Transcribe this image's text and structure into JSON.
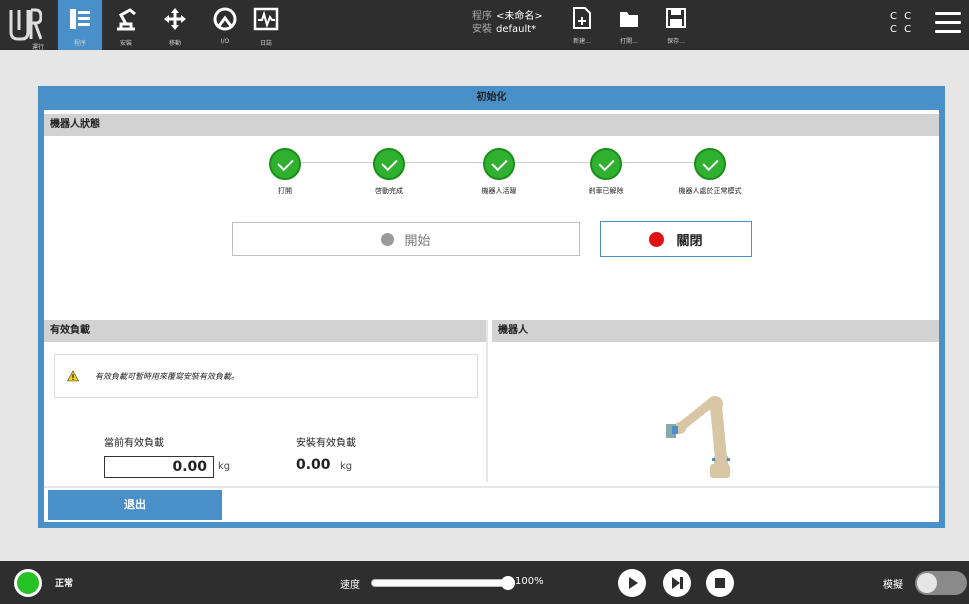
{
  "toolbar": {
    "nav": [
      {
        "label": "運行"
      },
      {
        "label": "程序"
      },
      {
        "label": "安裝"
      },
      {
        "label": "移動"
      },
      {
        "label": "I/O"
      },
      {
        "label": "日誌"
      }
    ],
    "program_key": "程序",
    "program_value": "<未命名>",
    "install_key": "安裝",
    "install_value": "default*",
    "file_buttons": [
      {
        "label": "新建..."
      },
      {
        "label": "打開..."
      },
      {
        "label": "保存..."
      }
    ],
    "cc_line1": "C C",
    "cc_line2": "C C"
  },
  "dialog": {
    "title": "初始化",
    "robot_state": {
      "heading": "機器人狀態",
      "steps": [
        {
          "label": "打開"
        },
        {
          "label": "啓動完成"
        },
        {
          "label": "機器人活躍"
        },
        {
          "label": "剎車已解除"
        },
        {
          "label": "機器人處於正常模式"
        }
      ],
      "start_label": "開始",
      "off_label": "關閉"
    },
    "payload": {
      "heading": "有效負載",
      "warning": "有效負載可暫時用來覆寫安裝有效負載。",
      "current_label": "當前有效負載",
      "current_value": "0.00",
      "current_unit": "kg",
      "install_label": "安裝有效負載",
      "install_value": "0.00",
      "install_unit": "kg"
    },
    "robot": {
      "heading": "機器人"
    },
    "exit_label": "退出"
  },
  "bottom": {
    "status": "正常",
    "speed_label": "速度",
    "speed_value": "100%",
    "speed_fraction": 1.0,
    "sim_label": "模擬"
  },
  "colors": {
    "accent": "#4a90c8",
    "ok": "#2fb12f",
    "stop": "#e01010",
    "bar": "#2e2e2e"
  }
}
